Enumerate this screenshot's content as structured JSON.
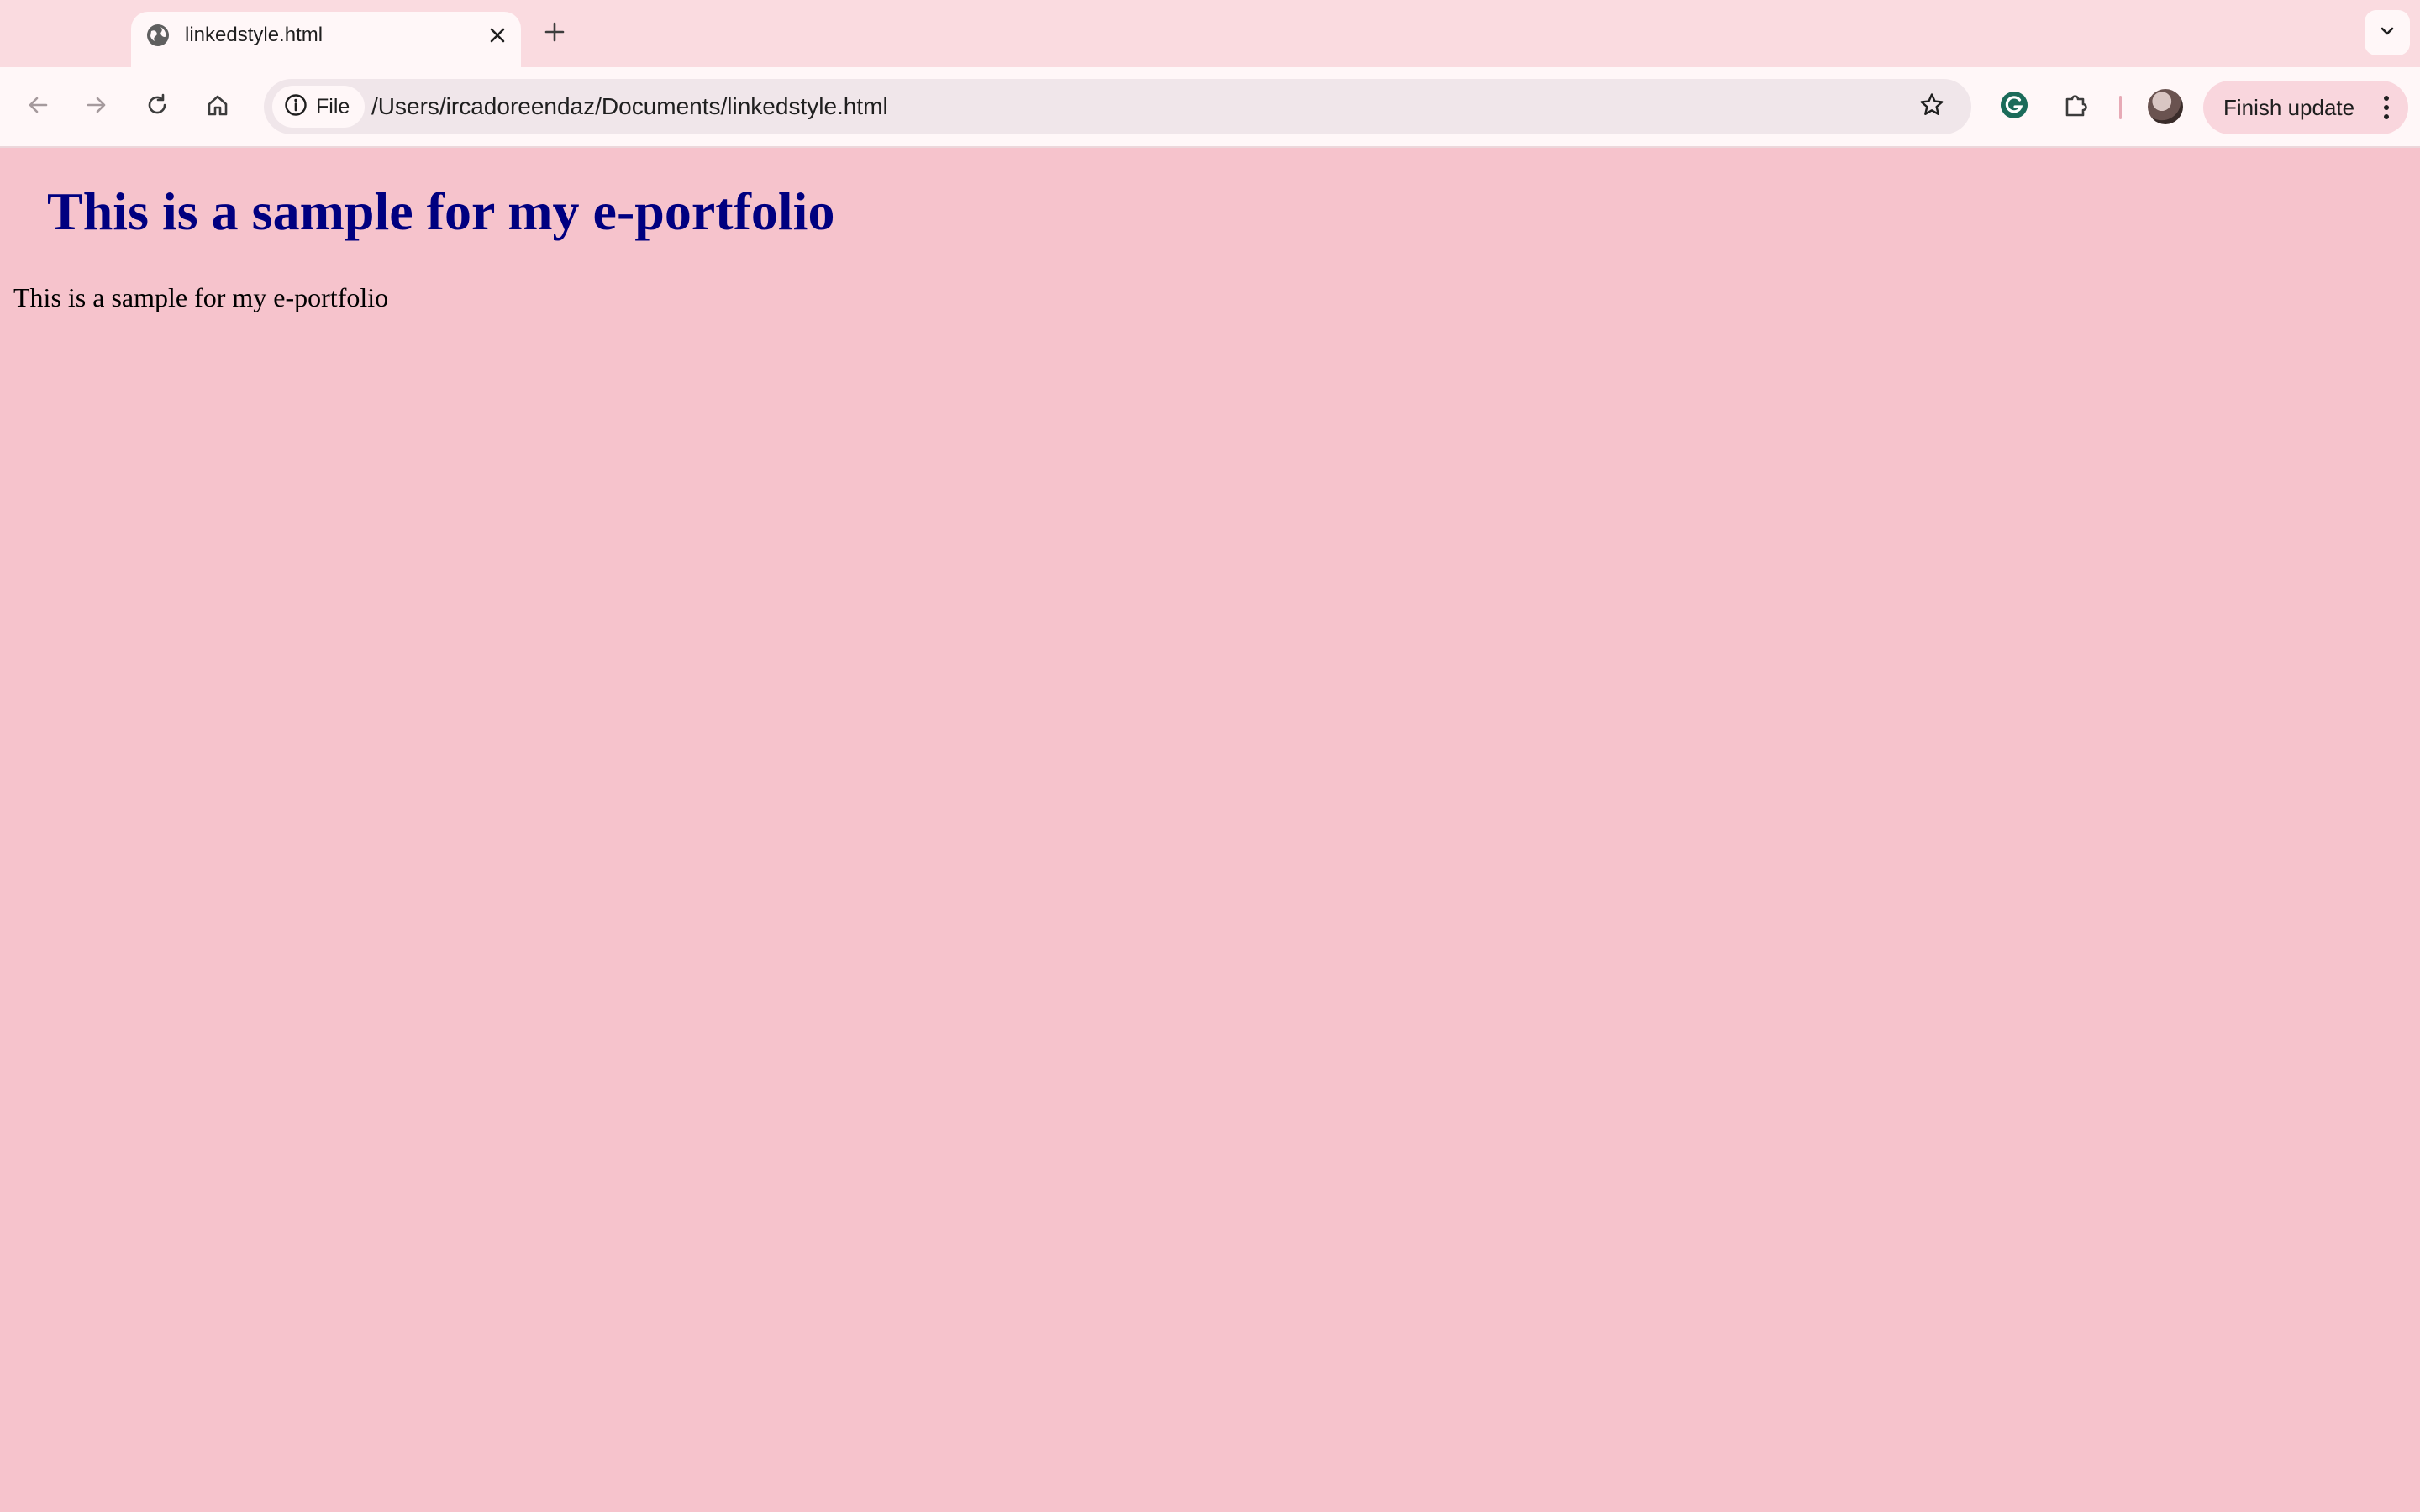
{
  "browser": {
    "tab": {
      "title": "linkedstyle.html",
      "favicon": "globe-icon"
    },
    "new_tab_icon": "plus-icon",
    "tab_search_icon": "chevron-down-icon",
    "toolbar": {
      "back_icon": "arrow-left-icon",
      "forward_icon": "arrow-right-icon",
      "reload_icon": "reload-icon",
      "home_icon": "home-icon",
      "site_info_label": "File",
      "url": "/Users/ircadoreendaz/Documents/linkedstyle.html",
      "bookmark_icon": "star-icon",
      "extensions": [
        "grammarly-icon",
        "puzzle-icon"
      ],
      "update_button_label": "Finish update",
      "menu_icon": "kebab-menu-icon"
    }
  },
  "page": {
    "heading": "This is a sample for my e-portfolio",
    "paragraph": "This is a sample for my e-portfolio"
  },
  "colors": {
    "page_background": "#f6c3cc",
    "heading_color": "#000080",
    "tabstrip_background": "#fadbe0",
    "toolbar_background": "#fff7f8",
    "grammarly_green": "#15c39a"
  }
}
